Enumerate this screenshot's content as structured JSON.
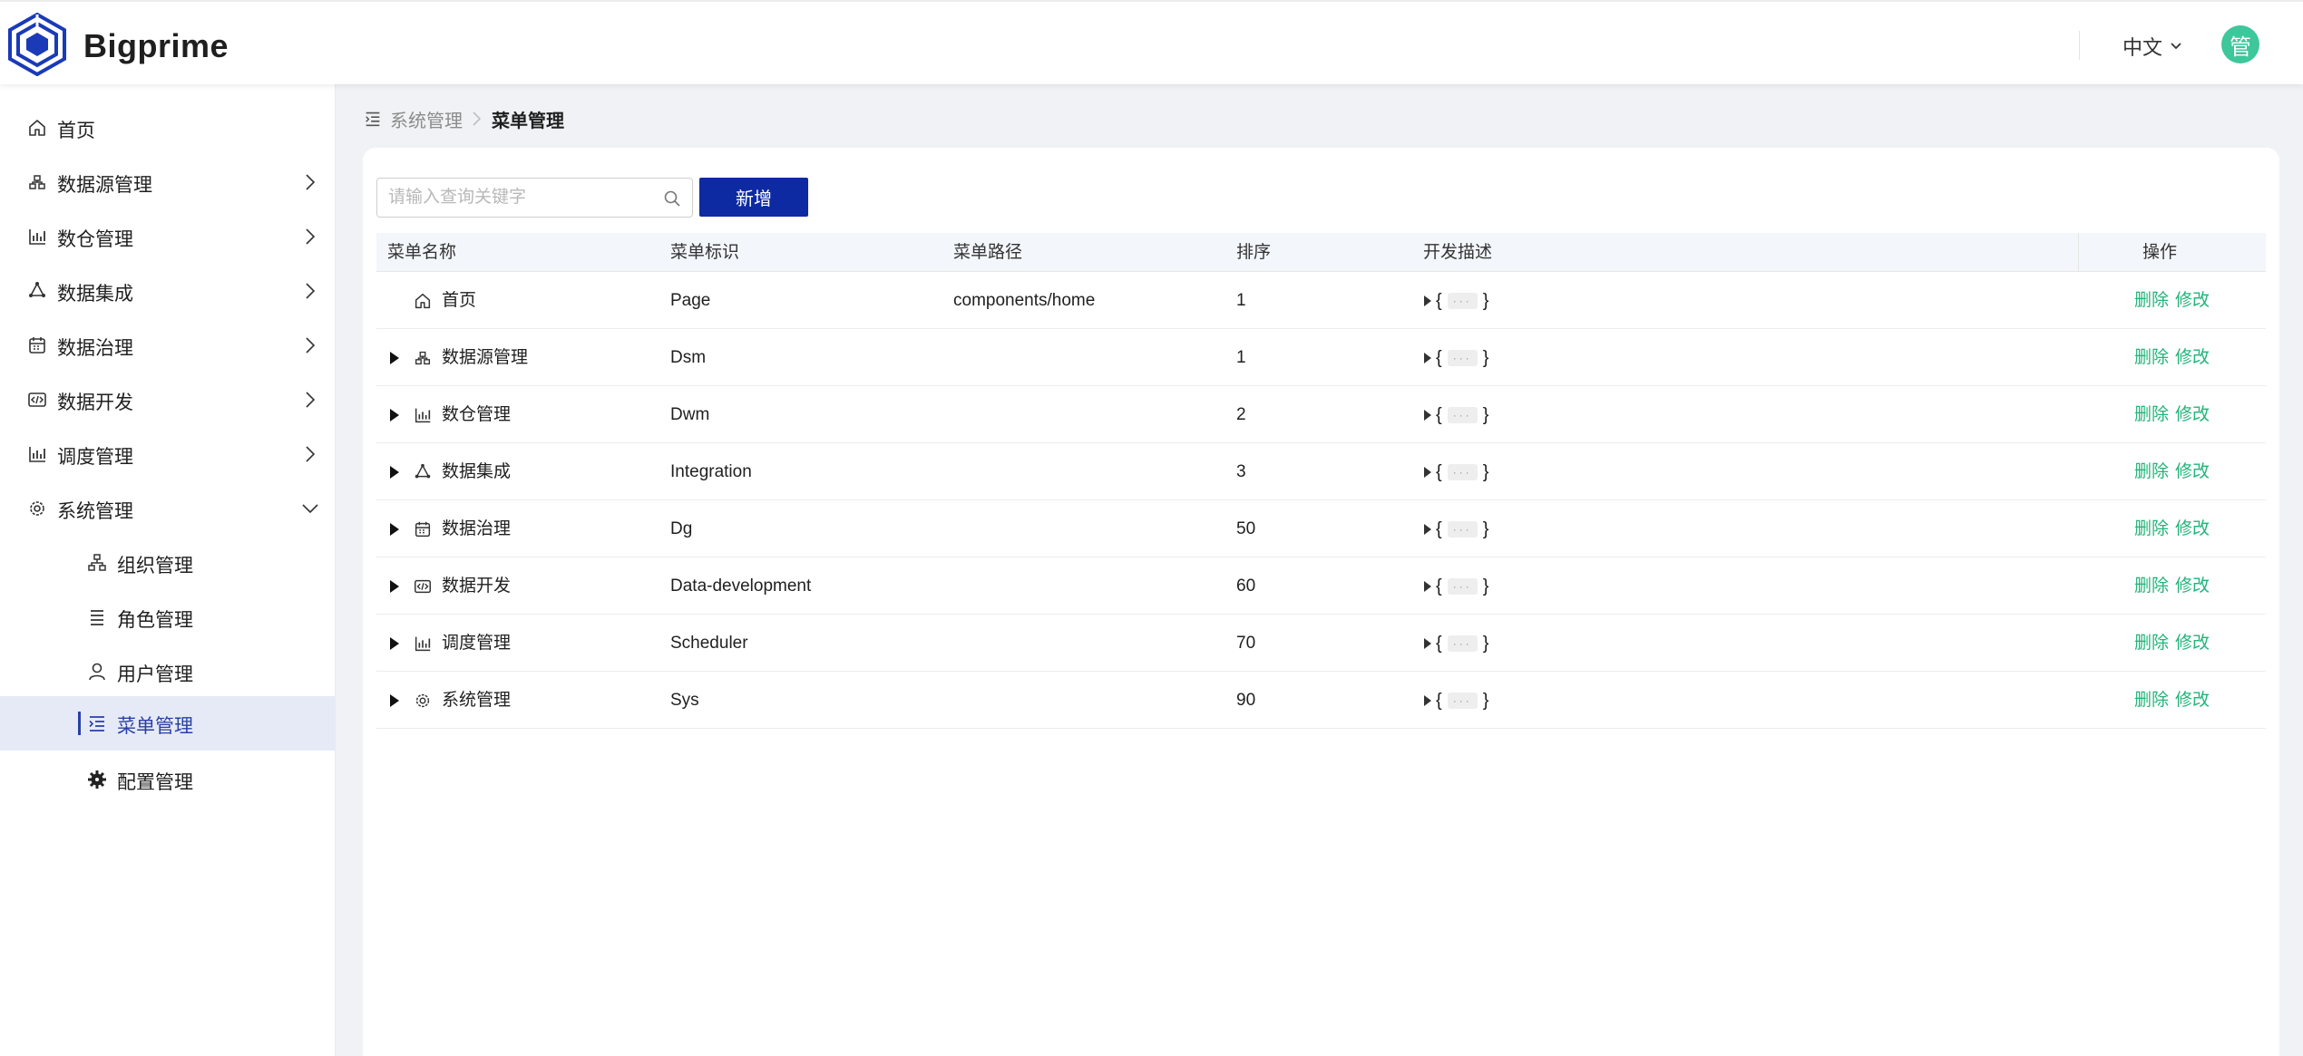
{
  "app": {
    "brand": "Bigprime"
  },
  "header": {
    "language": "中文",
    "avatar_text": "管"
  },
  "colors": {
    "primary": "#0e2aa2",
    "accent_green": "#21b47a",
    "avatar_bg": "#3dc79a",
    "active_menu_bg": "#e6eaf7"
  },
  "sidebar": {
    "items": [
      {
        "label": "首页",
        "icon": "home-icon"
      },
      {
        "label": "数据源管理",
        "icon": "datasource-icon"
      },
      {
        "label": "数仓管理",
        "icon": "bar-chart-icon"
      },
      {
        "label": "数据集成",
        "icon": "recycle-icon"
      },
      {
        "label": "数据治理",
        "icon": "calendar-icon"
      },
      {
        "label": "数据开发",
        "icon": "code-icon"
      },
      {
        "label": "调度管理",
        "icon": "bar-chart-icon"
      },
      {
        "label": "系统管理",
        "icon": "gear-icon"
      }
    ],
    "sub_items": [
      {
        "label": "组织管理",
        "icon": "org-icon"
      },
      {
        "label": "角色管理",
        "icon": "list-icon"
      },
      {
        "label": "用户管理",
        "icon": "user-icon"
      },
      {
        "label": "菜单管理",
        "icon": "menu-icon"
      },
      {
        "label": "配置管理",
        "icon": "cog-icon"
      }
    ]
  },
  "breadcrumb": {
    "parent": "系统管理",
    "current": "菜单管理"
  },
  "toolbar": {
    "search_placeholder": "请输入查询关键字",
    "add_label": "新增"
  },
  "table": {
    "headers": {
      "name": "菜单名称",
      "key": "菜单标识",
      "path": "菜单路径",
      "order": "排序",
      "desc": "开发描述",
      "ops": "操作"
    },
    "ellipsis": "···",
    "actions": {
      "delete": "删除",
      "edit": "修改"
    },
    "rows": [
      {
        "name": "首页",
        "key": "Page",
        "path": "components/home",
        "order": "1",
        "icon": "home-icon"
      },
      {
        "name": "数据源管理",
        "key": "Dsm",
        "path": "",
        "order": "1",
        "icon": "datasource-icon"
      },
      {
        "name": "数仓管理",
        "key": "Dwm",
        "path": "",
        "order": "2",
        "icon": "bar-chart-icon"
      },
      {
        "name": "数据集成",
        "key": "Integration",
        "path": "",
        "order": "3",
        "icon": "recycle-icon"
      },
      {
        "name": "数据治理",
        "key": "Dg",
        "path": "",
        "order": "50",
        "icon": "calendar-icon"
      },
      {
        "name": "数据开发",
        "key": "Data-development",
        "path": "",
        "order": "60",
        "icon": "code-icon"
      },
      {
        "name": "调度管理",
        "key": "Scheduler",
        "path": "",
        "order": "70",
        "icon": "bar-chart-icon"
      },
      {
        "name": "系统管理",
        "key": "Sys",
        "path": "",
        "order": "90",
        "icon": "gear-icon"
      }
    ]
  }
}
